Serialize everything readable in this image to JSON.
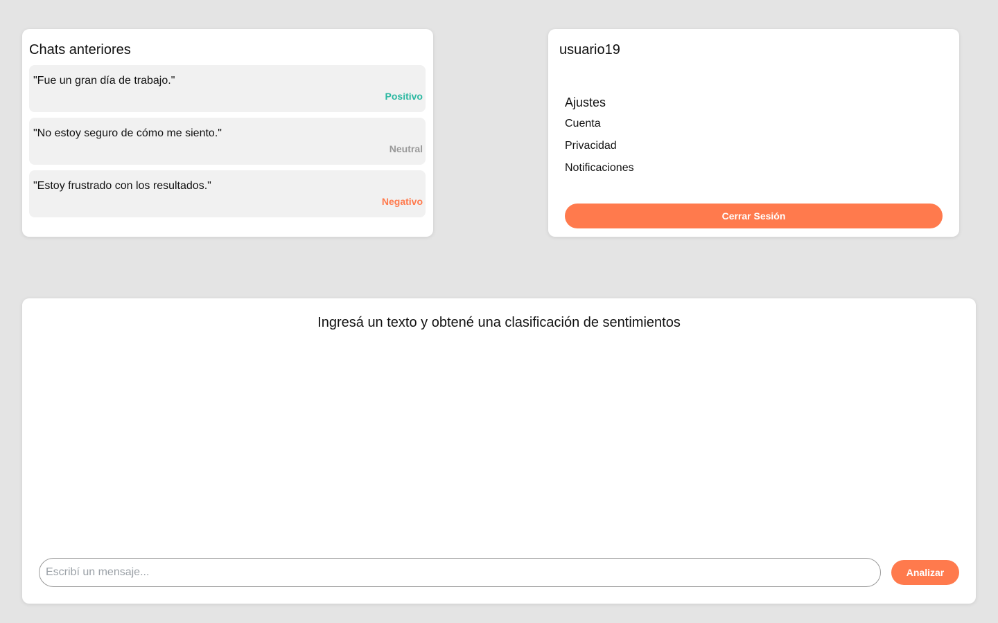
{
  "colors": {
    "background": "#e4e4e4",
    "card": "#ffffff",
    "accent": "#ff7a4d",
    "positive": "#2bb8a1",
    "neutral": "#999999",
    "negative": "#ff7a4d"
  },
  "history": {
    "title": "Chats anteriores",
    "items": [
      {
        "text": "\"Fue un gran día de trabajo.\"",
        "sentiment": "Positivo",
        "color": "#2bb8a1"
      },
      {
        "text": "\"No estoy seguro de cómo me siento.\"",
        "sentiment": "Neutral",
        "color": "#999999"
      },
      {
        "text": "\"Estoy frustrado con los resultados.\"",
        "sentiment": "Negativo",
        "color": "#ff7a4d"
      }
    ]
  },
  "profile": {
    "username": "usuario19",
    "settings_title": "Ajustes",
    "settings_items": [
      "Cuenta",
      "Privacidad",
      "Notificaciones"
    ],
    "logout_label": "Cerrar Sesión"
  },
  "main": {
    "title": "Ingresá un texto y obtené una clasificación de sentimientos",
    "input_placeholder": "Escribí un mensaje...",
    "input_value": "",
    "analyze_label": "Analizar"
  }
}
